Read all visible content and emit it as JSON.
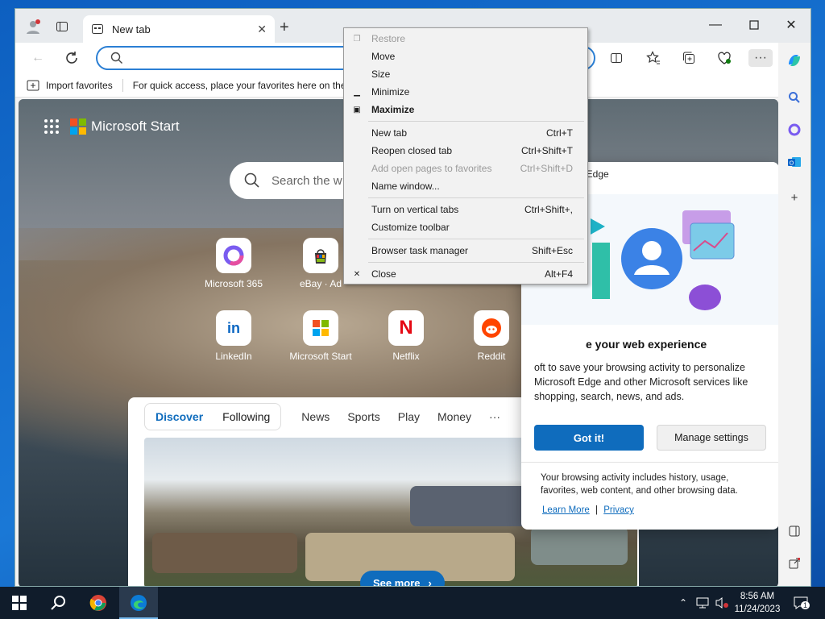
{
  "tab": {
    "title": "New tab"
  },
  "address": {
    "value": "",
    "placeholder": ""
  },
  "favorites_bar": {
    "import_label": "Import favorites",
    "hint": "For quick access, place your favorites here on the"
  },
  "page": {
    "brand": "Microsoft Start",
    "search_placeholder": "Search the w",
    "quick_links": [
      {
        "label": "Microsoft 365"
      },
      {
        "label": "eBay · Ad"
      },
      {
        "label": "LinkedIn"
      },
      {
        "label": "Microsoft Start"
      },
      {
        "label": "Netflix"
      },
      {
        "label": "Reddit"
      }
    ],
    "feed_tabs": {
      "discover": "Discover",
      "following": "Following",
      "news": "News",
      "sports": "Sports",
      "play": "Play",
      "money": "Money",
      "more": "···"
    },
    "see_more": "See more"
  },
  "popup": {
    "header_fragment": "t Edge",
    "title_fragment": "e your web experience",
    "body": "oft to save your browsing activity to personalize Microsoft Edge and other Microsoft services like shopping, search, news, and ads.",
    "got_it": "Got it!",
    "manage": "Manage settings",
    "footer": "Your browsing activity includes history, usage, favorites, web content, and other browsing data.",
    "learn_more": "Learn More",
    "link_sep": "|",
    "privacy": "Privacy"
  },
  "context_menu": {
    "items": [
      {
        "label": "Restore",
        "shortcut": "",
        "disabled": true,
        "glyph": "restore"
      },
      {
        "label": "Move",
        "shortcut": ""
      },
      {
        "label": "Size",
        "shortcut": ""
      },
      {
        "label": "Minimize",
        "shortcut": "",
        "glyph": "minimize"
      },
      {
        "label": "Maximize",
        "shortcut": "",
        "glyph": "maximize",
        "bold": true
      },
      {
        "label": "New tab",
        "shortcut": "Ctrl+T"
      },
      {
        "label": "Reopen closed tab",
        "shortcut": "Ctrl+Shift+T"
      },
      {
        "label": "Add open pages to favorites",
        "shortcut": "Ctrl+Shift+D",
        "disabled": true
      },
      {
        "label": "Name window...",
        "shortcut": ""
      },
      {
        "label": "Turn on vertical tabs",
        "shortcut": "Ctrl+Shift+,"
      },
      {
        "label": "Customize toolbar",
        "shortcut": ""
      },
      {
        "label": "Browser task manager",
        "shortcut": "Shift+Esc"
      },
      {
        "label": "Close",
        "shortcut": "Alt+F4",
        "glyph": "close"
      }
    ]
  },
  "taskbar": {
    "time": "8:56 AM",
    "date": "11/24/2023",
    "notification_count": "1"
  },
  "colors": {
    "accent": "#0f6cbd",
    "taskbar": "#101c2b",
    "menu_bg": "#f2f2f2"
  }
}
